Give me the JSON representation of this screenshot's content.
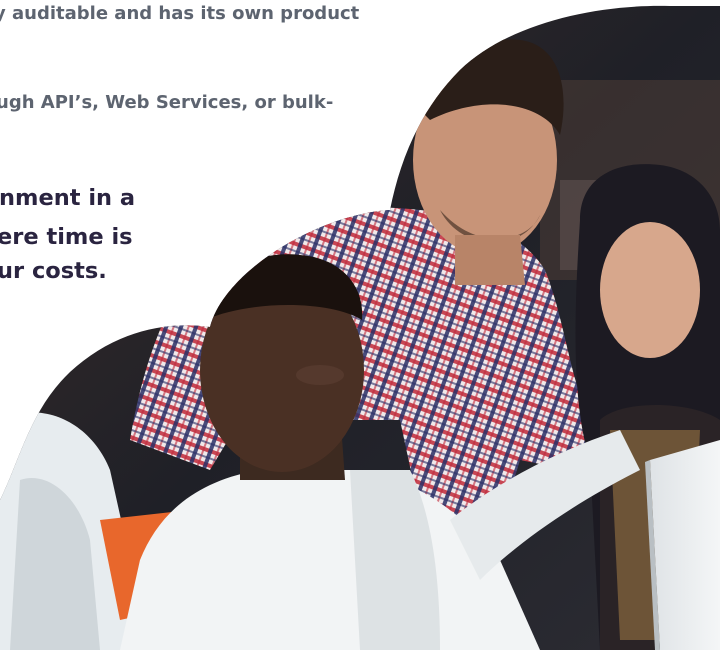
{
  "copy": {
    "line_1": "y auditable and has its own product",
    "line_2": "ugh API’s, Web Services, or bulk-",
    "lead_1": "nment in a",
    "lead_2": "ere time is",
    "lead_3": "ur costs."
  },
  "photo": {
    "subject": "team-working-at-laptop"
  },
  "colors": {
    "body_text": "#5d6470",
    "lead_text": "#2a2440",
    "background": "#ffffff"
  }
}
